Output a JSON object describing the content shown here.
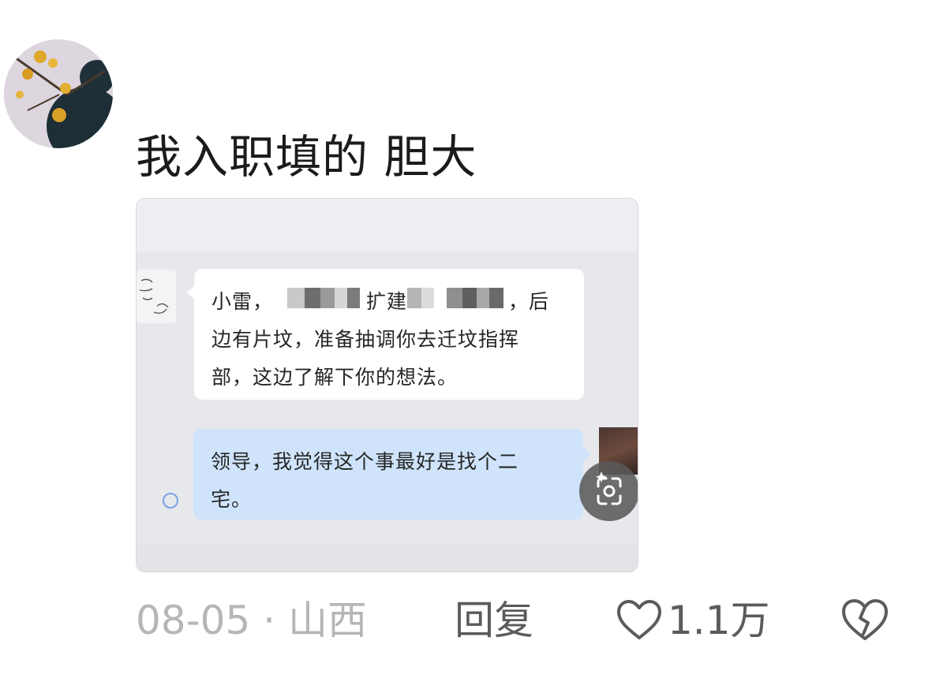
{
  "comment": {
    "text": "我入职填的  胆大",
    "avatar_icon": "user-avatar-flower"
  },
  "screenshot": {
    "incoming_message": {
      "line1_start": "小雷，",
      "line1_mid": "扩建",
      "line1_end": "，后",
      "line2": "边有片坟，准备抽调你去迁坟指挥",
      "line3": "部，这边了解下你的想法。"
    },
    "outgoing_message": {
      "line1": "领导，我觉得这个事最好是找个二",
      "line2": "宅。"
    },
    "scan_icon": "image-scan-icon"
  },
  "footer": {
    "date_location": "08-05 · 山西",
    "reply_label": "回复",
    "like_count": "1.1万",
    "like_icon": "heart-icon",
    "dislike_icon": "broken-heart-icon"
  },
  "colors": {
    "bubble_incoming": "#ffffff",
    "bubble_outgoing": "#cfe4fb",
    "meta_gray": "#b6b6b6",
    "action_gray": "#5b5b5b"
  }
}
